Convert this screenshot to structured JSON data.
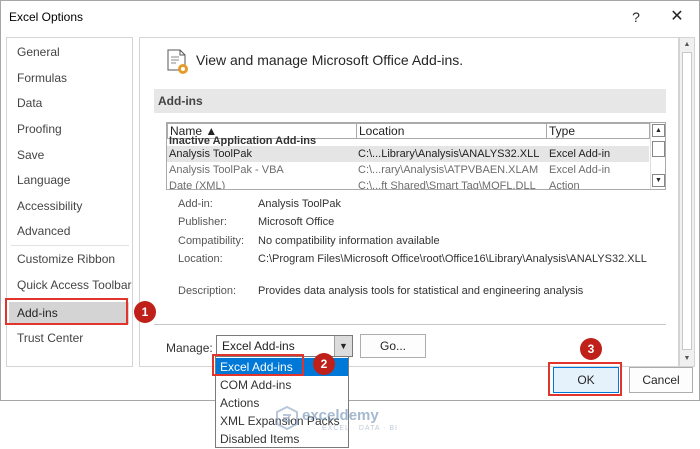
{
  "window": {
    "title": "Excel Options",
    "help": "?",
    "close": "✕"
  },
  "nav": {
    "items": [
      {
        "label": "General"
      },
      {
        "label": "Formulas"
      },
      {
        "label": "Data"
      },
      {
        "label": "Proofing"
      },
      {
        "label": "Save"
      },
      {
        "label": "Language"
      },
      {
        "label": "Accessibility"
      },
      {
        "label": "Advanced"
      },
      {
        "label": "Customize Ribbon"
      },
      {
        "label": "Quick Access Toolbar"
      },
      {
        "label": "Add-ins",
        "selected": true
      },
      {
        "label": "Trust Center"
      }
    ]
  },
  "header": {
    "text": "View and manage Microsoft Office Add-ins."
  },
  "section": {
    "label": "Add-ins"
  },
  "table": {
    "columns": [
      "Name ▲",
      "Location",
      "Type"
    ],
    "group_row": "Inactive Application Add-ins",
    "rows": [
      {
        "name": "Analysis ToolPak",
        "location": "C:\\...Library\\Analysis\\ANALYS32.XLL",
        "type": "Excel Add-in"
      },
      {
        "name": "Analysis ToolPak - VBA",
        "location": "C:\\...rary\\Analysis\\ATPVBAEN.XLAM",
        "type": "Excel Add-in"
      },
      {
        "name": "Date (XML)",
        "location": "C:\\...ft Shared\\Smart Tag\\MOFL.DLL",
        "type": "Action"
      }
    ]
  },
  "details": {
    "addin_label": "Add-in:",
    "addin_value": "Analysis ToolPak",
    "publisher_label": "Publisher:",
    "publisher_value": "Microsoft Office",
    "compat_label": "Compatibility:",
    "compat_value": "No compatibility information available",
    "location_label": "Location:",
    "location_value": "C:\\Program Files\\Microsoft Office\\root\\Office16\\Library\\Analysis\\ANALYS32.XLL",
    "description_label": "Description:",
    "description_value": "Provides data analysis tools for statistical and engineering analysis"
  },
  "manage": {
    "label": "Manage:",
    "selected": "Excel Add-ins",
    "go_label": "Go...",
    "options": [
      "Excel Add-ins",
      "COM Add-ins",
      "Actions",
      "XML Expansion Packs",
      "Disabled Items"
    ]
  },
  "buttons": {
    "ok": "OK",
    "cancel": "Cancel"
  },
  "badges": {
    "one": "1",
    "two": "2",
    "three": "3"
  },
  "watermark": {
    "name": "exceldemy",
    "tagline": "EXCEL · DATA · BI"
  },
  "colors": {
    "highlight_red": "#e0342d",
    "badge_red": "#c0201a",
    "select_blue": "#0078d7"
  }
}
